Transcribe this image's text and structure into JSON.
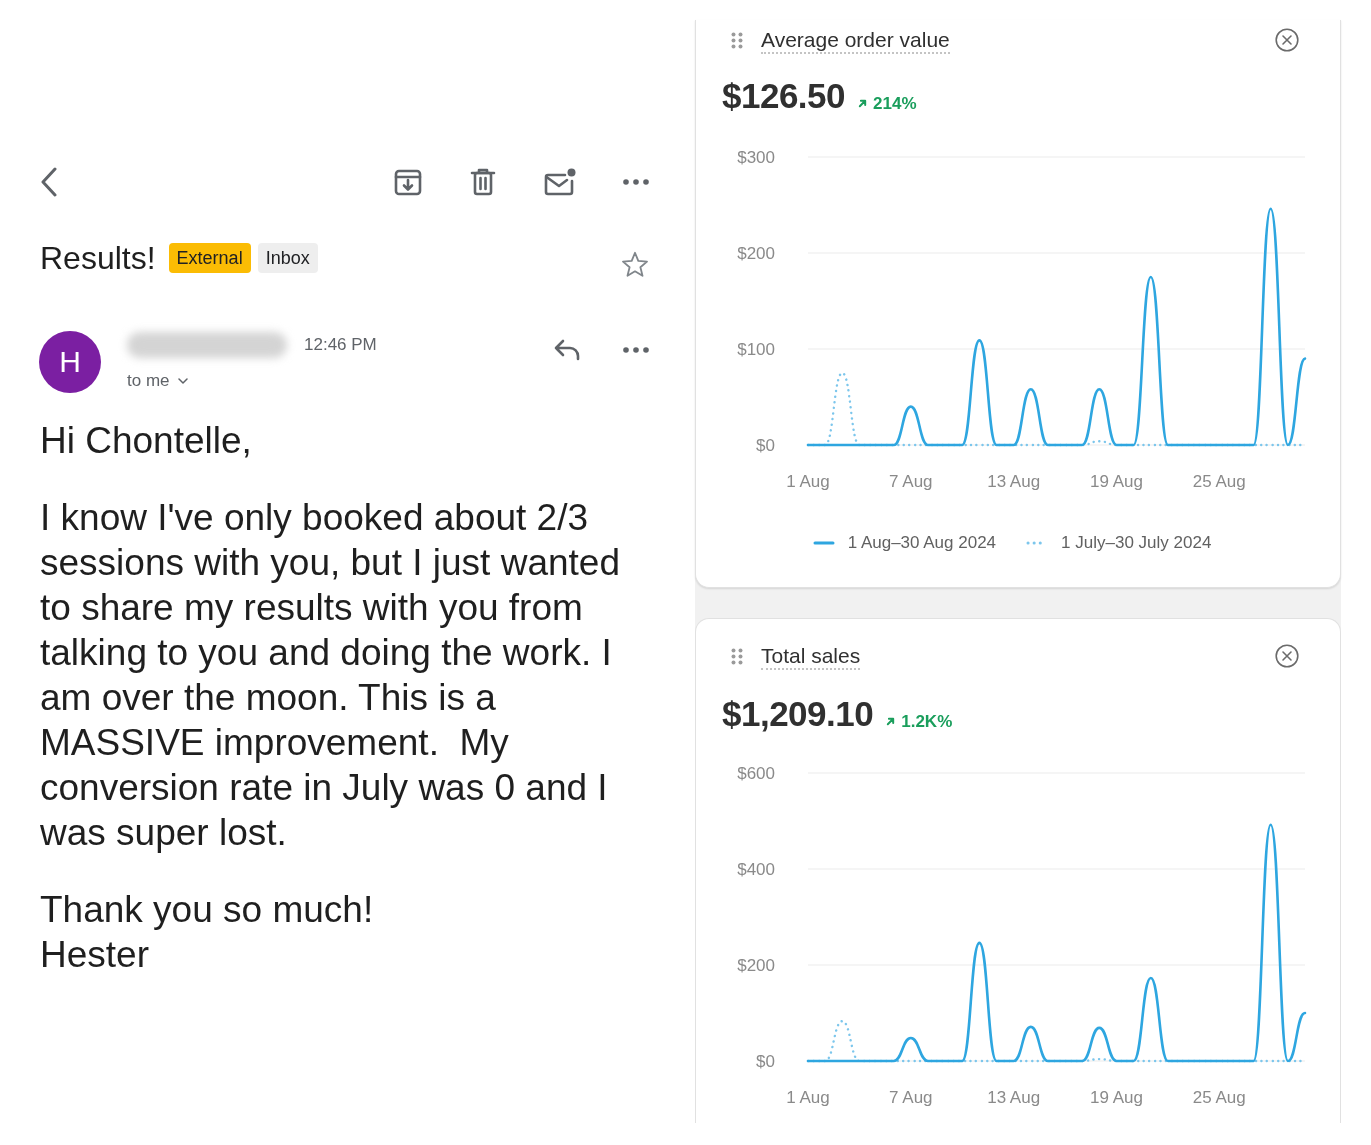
{
  "email": {
    "subject": "Results!",
    "labels": [
      {
        "text": "External",
        "color": "#fbbc04"
      },
      {
        "text": "Inbox",
        "color": "#eeeeee"
      }
    ],
    "starred": false,
    "sender": {
      "avatar_letter": "H",
      "time": "12:46 PM",
      "recipients": "to me"
    },
    "body": {
      "greeting": "Hi Chontelle,",
      "paragraph": "I know I've only booked about 2/3 sessions with you, but I just wanted to share my results with you from talking to you and doing the work. I am over the moon. This is a MASSIVE improvement.  My conversion rate in July was 0 and I was super lost.",
      "closing": "Thank you so much!",
      "signature": "Hester"
    }
  },
  "analytics": {
    "cards": [
      {
        "title": "Average order value",
        "value": "$126.50",
        "change": "214%",
        "chart_data": {
          "type": "line",
          "legend": "bottom",
          "categories": [
            "1 Aug",
            null,
            null,
            null,
            null,
            null,
            "7 Aug",
            null,
            null,
            null,
            null,
            null,
            "13 Aug",
            null,
            null,
            null,
            null,
            null,
            "19 Aug",
            null,
            null,
            null,
            null,
            null,
            "25 Aug",
            null,
            null,
            null,
            null,
            null
          ],
          "ylim": [
            0,
            300
          ],
          "yticks": [
            {
              "value": 0,
              "label": "$0"
            },
            {
              "value": 100,
              "label": "$100"
            },
            {
              "value": 200,
              "label": "$200"
            },
            {
              "value": 300,
              "label": "$300"
            }
          ],
          "series": [
            {
              "name": "1 Aug–30 Aug 2024",
              "color": "#2ea6e0",
              "line_style": "solid",
              "values": [
                0,
                0,
                0,
                0,
                0,
                0,
                40,
                0,
                0,
                0,
                109,
                0,
                0,
                58,
                0,
                0,
                0,
                58,
                0,
                0,
                175,
                0,
                0,
                0,
                0,
                0,
                0,
                246,
                0,
                90
              ]
            },
            {
              "name": "1 July–30 July 2024",
              "color": "#7cc6ec",
              "line_style": "dotted",
              "values": [
                0,
                0,
                75,
                0,
                0,
                0,
                0,
                0,
                0,
                0,
                0,
                0,
                0,
                0,
                0,
                0,
                0,
                4,
                0,
                0,
                0,
                0,
                0,
                0,
                0,
                0,
                0,
                0,
                0,
                0
              ]
            }
          ]
        }
      },
      {
        "title": "Total sales",
        "value": "$1,209.10",
        "change": "1.2K%",
        "chart_data": {
          "type": "line",
          "categories": [
            "1 Aug",
            null,
            null,
            null,
            null,
            null,
            "7 Aug",
            null,
            null,
            null,
            null,
            null,
            "13 Aug",
            null,
            null,
            null,
            null,
            null,
            "19 Aug",
            null,
            null,
            null,
            null,
            null,
            "25 Aug",
            null,
            null,
            null,
            null,
            null
          ],
          "ylim": [
            0,
            600
          ],
          "yticks": [
            {
              "value": 0,
              "label": "$0"
            },
            {
              "value": 200,
              "label": "$200"
            },
            {
              "value": 400,
              "label": "$400"
            },
            {
              "value": 600,
              "label": "$600"
            }
          ],
          "series": [
            {
              "color": "#2ea6e0",
              "line_style": "solid",
              "values": [
                0,
                0,
                0,
                0,
                0,
                0,
                48,
                0,
                0,
                0,
                246,
                0,
                0,
                71,
                0,
                0,
                0,
                69,
                0,
                0,
                173,
                0,
                0,
                0,
                0,
                0,
                0,
                492,
                0,
                100
              ]
            },
            {
              "color": "#7cc6ec",
              "line_style": "dotted",
              "values": [
                0,
                0,
                83,
                0,
                0,
                0,
                0,
                0,
                0,
                0,
                0,
                0,
                0,
                0,
                0,
                0,
                0,
                4,
                0,
                0,
                0,
                0,
                0,
                0,
                0,
                0,
                0,
                0,
                0,
                0
              ]
            }
          ]
        }
      }
    ]
  }
}
